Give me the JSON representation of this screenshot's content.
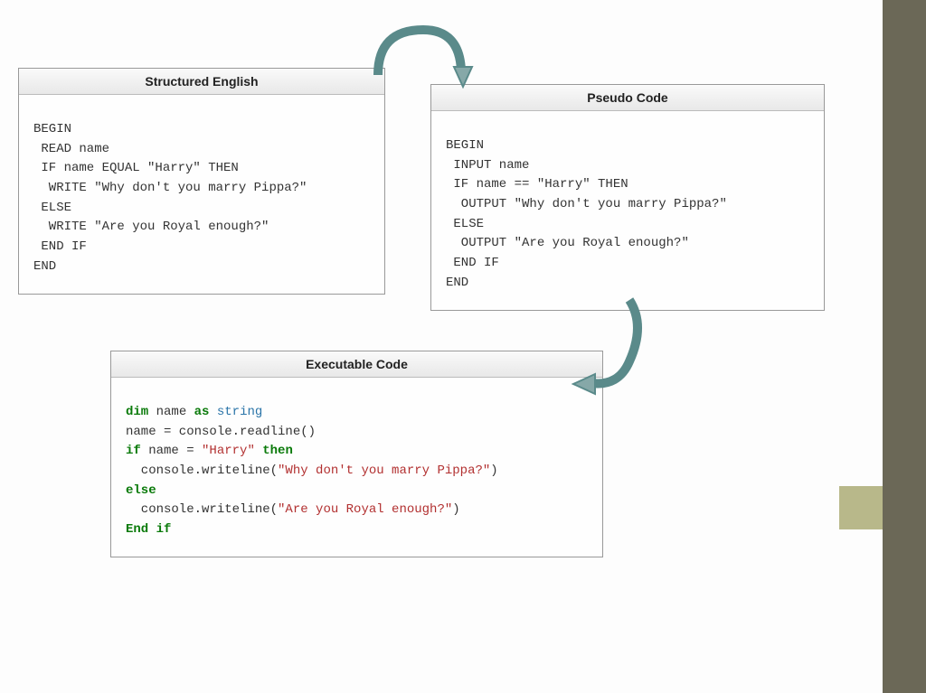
{
  "panel1": {
    "title": "Structured English",
    "lines": [
      "BEGIN",
      " READ name",
      " IF name EQUAL \"Harry\" THEN",
      "  WRITE \"Why don't you marry Pippa?\"",
      " ELSE",
      "  WRITE \"Are you Royal enough?\"",
      " END IF",
      "END"
    ]
  },
  "panel2": {
    "title": "Pseudo Code",
    "lines": [
      "BEGIN",
      " INPUT name",
      " IF name == \"Harry\" THEN",
      "  OUTPUT \"Why don't you marry Pippa?\"",
      " ELSE",
      "  OUTPUT \"Are you Royal enough?\"",
      " END IF",
      "END"
    ]
  },
  "panel3": {
    "title": "Executable Code",
    "tokens": [
      {
        "t": "dim",
        "c": "kw"
      },
      {
        "t": " name "
      },
      {
        "t": "as",
        "c": "kw"
      },
      {
        "t": " "
      },
      {
        "t": "string",
        "c": "type"
      },
      {
        "t": "\n"
      },
      {
        "t": "name = console.readline()\n"
      },
      {
        "t": "if",
        "c": "kw"
      },
      {
        "t": " name = "
      },
      {
        "t": "\"Harry\"",
        "c": "str"
      },
      {
        "t": " "
      },
      {
        "t": "then",
        "c": "kw"
      },
      {
        "t": "\n"
      },
      {
        "t": "  console.writeline("
      },
      {
        "t": "\"Why don't you marry Pippa?\"",
        "c": "str"
      },
      {
        "t": ")\n"
      },
      {
        "t": "else",
        "c": "kw"
      },
      {
        "t": "\n"
      },
      {
        "t": "  console.writeline("
      },
      {
        "t": "\"Are you Royal enough?\"",
        "c": "str"
      },
      {
        "t": ")\n"
      },
      {
        "t": "End if",
        "c": "kw"
      }
    ]
  }
}
